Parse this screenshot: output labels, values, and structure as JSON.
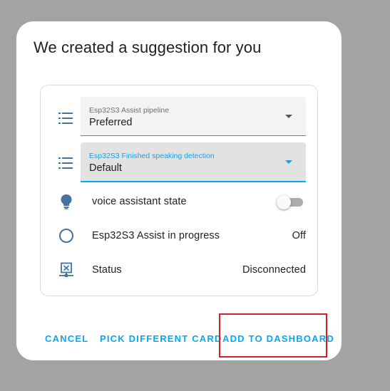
{
  "dialog": {
    "title": "We created a suggestion for you"
  },
  "card": {
    "selects": [
      {
        "label": "Esp32S3 Assist pipeline",
        "value": "Preferred",
        "icon": "format-list-bulleted-icon"
      },
      {
        "label": "Esp32S3 Finished speaking detection",
        "value": "Default",
        "icon": "format-list-bulleted-icon"
      }
    ],
    "entities": [
      {
        "name": "voice assistant state",
        "icon": "lightbulb-icon",
        "control": "toggle",
        "toggle_on": false
      },
      {
        "name": "Esp32S3 Assist in progress",
        "icon": "circle-outline-icon",
        "state": "Off"
      },
      {
        "name": "Status",
        "icon": "network-off-icon",
        "state": "Disconnected"
      }
    ]
  },
  "actions": {
    "cancel": "CANCEL",
    "pick_different": "PICK DIFFERENT CARD",
    "add_to_dashboard": "ADD TO DASHBOARD"
  },
  "colors": {
    "accent": "#03a9f4",
    "icon": "#44739e",
    "highlight": "#d0202a",
    "backdrop": "#a3a3a3"
  }
}
